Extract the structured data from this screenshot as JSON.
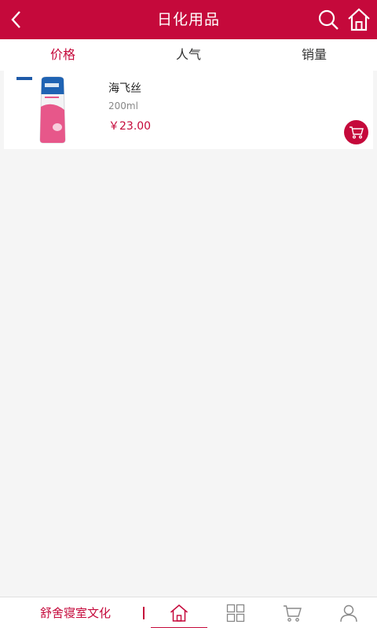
{
  "header": {
    "title": "日化用品",
    "back_icon": "chevron-left-icon",
    "search_icon": "search-icon",
    "home_icon": "home-icon"
  },
  "tabs": [
    {
      "label": "价格",
      "active": true
    },
    {
      "label": "人气",
      "active": false
    },
    {
      "label": "销量",
      "active": false
    }
  ],
  "products": [
    {
      "name": "海飞丝",
      "spec": "200ml",
      "price": "￥23.00",
      "cart_icon": "cart-icon"
    }
  ],
  "bottom_nav": {
    "brand": "舒舍寝室文化",
    "items": [
      {
        "icon": "home-icon",
        "active": true
      },
      {
        "icon": "grid-icon",
        "active": false
      },
      {
        "icon": "cart-icon",
        "active": false
      },
      {
        "icon": "user-icon",
        "active": false
      }
    ]
  },
  "colors": {
    "accent": "#c5093b",
    "background": "#f5f5f5"
  }
}
